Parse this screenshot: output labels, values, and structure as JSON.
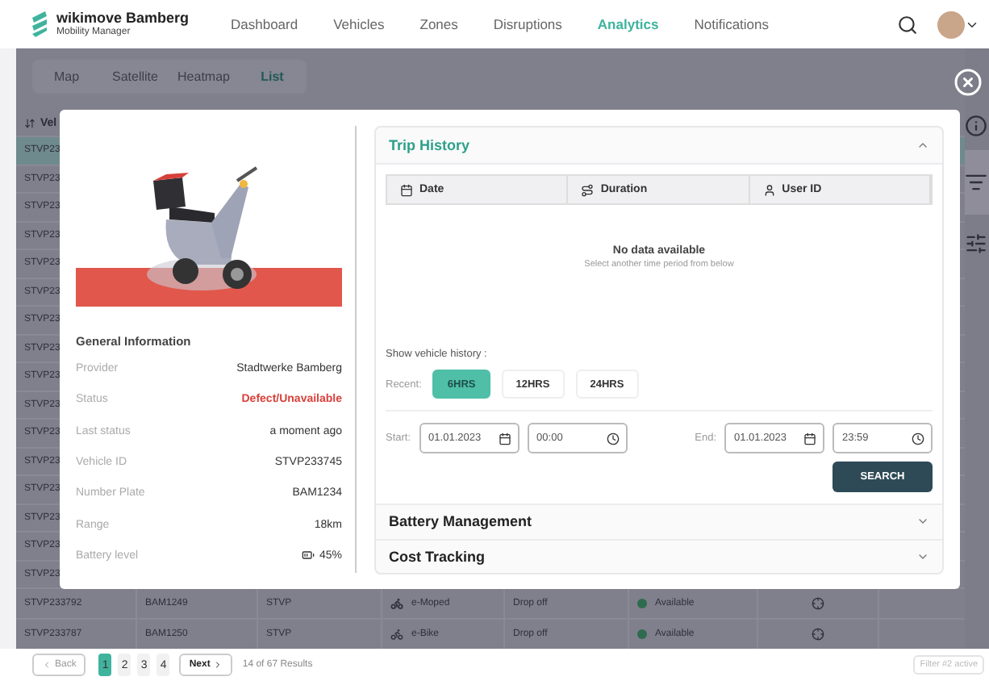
{
  "header": {
    "brand": "wikimove Bamberg",
    "subtitle": "Mobility Manager",
    "nav": [
      {
        "label": "Dashboard",
        "selected": false
      },
      {
        "label": "Vehicles",
        "selected": false
      },
      {
        "label": "Zones",
        "selected": false
      },
      {
        "label": "Disruptions",
        "selected": false
      },
      {
        "label": "Analytics",
        "selected": true
      },
      {
        "label": "Notifications",
        "selected": false
      }
    ]
  },
  "view_tabs": [
    {
      "label": "Map",
      "selected": false
    },
    {
      "label": "Satellite",
      "selected": false
    },
    {
      "label": "Heatmap",
      "selected": false
    },
    {
      "label": "List",
      "selected": true
    }
  ],
  "vehicle_table": {
    "header": "Vel",
    "covered_rows": [
      {
        "id": "STVP23",
        "selected": true
      },
      {
        "id": "STVP23",
        "selected": false
      },
      {
        "id": "STVP23",
        "selected": false
      },
      {
        "id": "STVP23",
        "selected": false
      },
      {
        "id": "STVP23",
        "selected": false
      },
      {
        "id": "STVP23",
        "selected": false
      },
      {
        "id": "STVP23",
        "selected": false
      },
      {
        "id": "STVP23",
        "selected": false
      },
      {
        "id": "STVP23",
        "selected": false
      },
      {
        "id": "STVP23",
        "selected": false
      },
      {
        "id": "STVP23",
        "selected": false
      },
      {
        "id": "STVP23",
        "selected": false
      },
      {
        "id": "STVP23",
        "selected": false
      },
      {
        "id": "STVP23",
        "selected": false
      },
      {
        "id": "STVP23",
        "selected": false
      },
      {
        "id": "STVP23",
        "selected": false
      }
    ],
    "rows": [
      {
        "id": "STVP233792",
        "plate": "BAM1249",
        "provider": "STVP",
        "kind": "moped",
        "type": "e-Moped",
        "mode": "Drop off",
        "status": "Available",
        "color": "#2f6b4f"
      },
      {
        "id": "STVP233787",
        "plate": "BAM1250",
        "provider": "STVP",
        "kind": "bike",
        "type": "e-Bike",
        "mode": "Drop off",
        "status": "Available",
        "color": "#2f6b4f"
      }
    ]
  },
  "pagination": {
    "back": "Back",
    "pages": [
      {
        "label": "1",
        "selected": true
      },
      {
        "label": "2",
        "selected": false
      },
      {
        "label": "3",
        "selected": false
      },
      {
        "label": "4",
        "selected": false
      }
    ],
    "next": "Next",
    "results": "14 of 67 Results",
    "filter_badge": "Filter #2 active"
  },
  "modal": {
    "general_info": {
      "title": "General Information",
      "fields": [
        {
          "label": "Provider",
          "value": "Stadtwerke Bamberg",
          "kind": "text",
          "alert": false
        },
        {
          "label": "Status",
          "value": "Defect/Unavailable",
          "kind": "text",
          "alert": true
        },
        {
          "label": "Last status",
          "value": "a moment ago",
          "kind": "text",
          "alert": false
        },
        {
          "label": "Vehicle ID",
          "value": "STVP233745",
          "kind": "text",
          "alert": false
        },
        {
          "label": "Number Plate",
          "value": "BAM1234",
          "kind": "text",
          "alert": false
        },
        {
          "label": "Range",
          "value": "18km",
          "kind": "text",
          "alert": false
        },
        {
          "label": "Battery level",
          "value": "45%",
          "kind": "battery",
          "alert": false
        }
      ]
    },
    "sections": [
      {
        "title": "Trip History",
        "expanded": true
      },
      {
        "title": "Battery Management",
        "expanded": false
      },
      {
        "title": "Cost Tracking",
        "expanded": false
      }
    ],
    "trip_history": {
      "columns": [
        {
          "label": "Date",
          "kind": "date"
        },
        {
          "label": "Duration",
          "kind": "duration"
        },
        {
          "label": "User ID",
          "kind": "user"
        }
      ],
      "empty_title": "No data available",
      "empty_hint": "Select another time period from below",
      "history_label": "Show vehicle history :",
      "recent_label": "Recent:",
      "ranges": [
        {
          "label": "6HRS",
          "selected": true
        },
        {
          "label": "12HRS",
          "selected": false
        },
        {
          "label": "24HRS",
          "selected": false
        }
      ],
      "start_label": "Start:",
      "start_date": "01.01.2023",
      "start_time": "00:00",
      "end_label": "End:",
      "end_date": "01.01.2023",
      "end_time": "23:59",
      "search": "SEARCH"
    }
  }
}
